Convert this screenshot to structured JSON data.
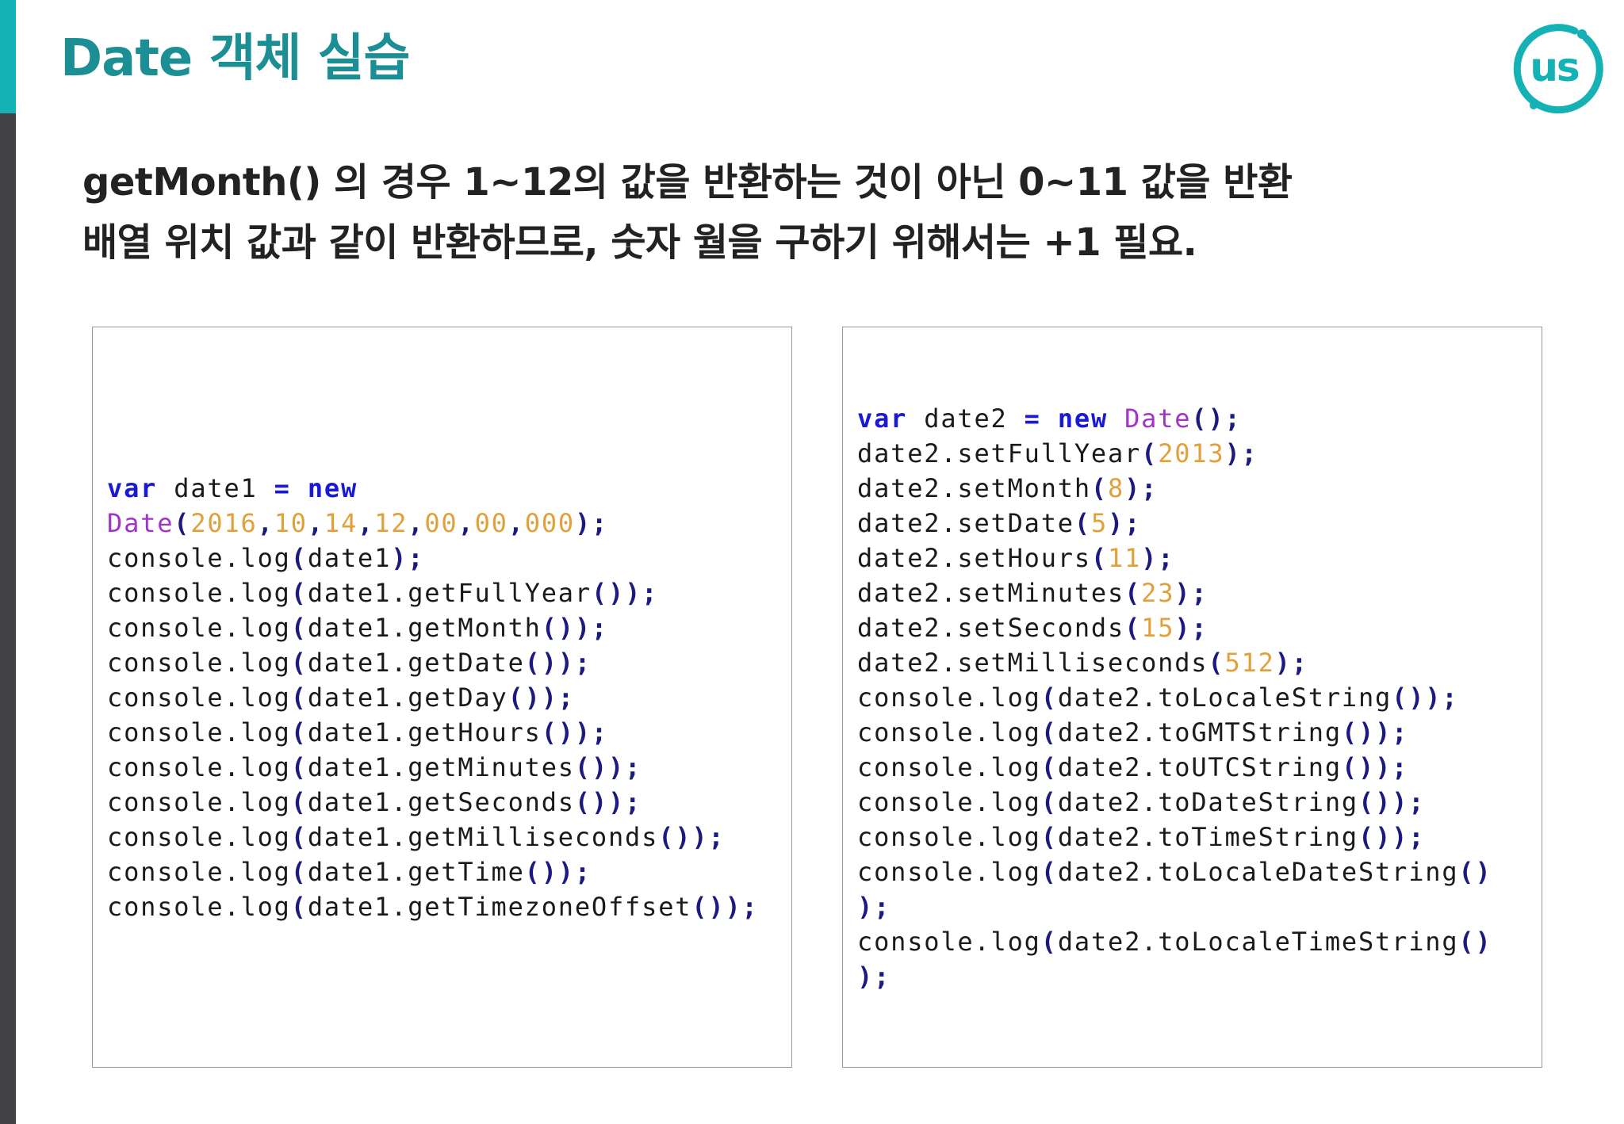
{
  "slide": {
    "title": "Date 객체 실습",
    "logo_text": "us",
    "description": [
      "getMonth() 의 경우 1~12의 값을 반환하는 것이 아닌 0~11 값을 반환",
      "배열 위치 값과 같이 반환하므로, 숫자 월을 구하기 위해서는 +1 필요."
    ]
  },
  "colors": {
    "title": "#1c8f94",
    "accent_bar": "#14b1b5",
    "side_bar": "#434246",
    "keyword": "#1a1ad4",
    "class_name": "#a233c9",
    "number": "#e0a03a",
    "punctuation": "#1a1a80"
  },
  "code_blocks": [
    {
      "lines": [
        [
          [
            "kw",
            "var"
          ],
          [
            "t",
            " date1 "
          ],
          [
            "kw",
            "="
          ],
          [
            "t",
            " "
          ],
          [
            "kw",
            "new"
          ]
        ],
        [
          [
            "cls",
            "Date"
          ],
          [
            "p",
            "("
          ],
          [
            "num",
            "2016"
          ],
          [
            "p",
            ","
          ],
          [
            "num",
            "10"
          ],
          [
            "p",
            ","
          ],
          [
            "num",
            "14"
          ],
          [
            "p",
            ","
          ],
          [
            "num",
            "12"
          ],
          [
            "p",
            ","
          ],
          [
            "num",
            "00"
          ],
          [
            "p",
            ","
          ],
          [
            "num",
            "00"
          ],
          [
            "p",
            ","
          ],
          [
            "num",
            "000"
          ],
          [
            "p",
            ");"
          ]
        ],
        [
          [
            "t",
            "console.log"
          ],
          [
            "p",
            "("
          ],
          [
            "t",
            "date1"
          ],
          [
            "p",
            ");"
          ]
        ],
        [
          [
            "t",
            "console.log"
          ],
          [
            "p",
            "("
          ],
          [
            "t",
            "date1.getFullYear"
          ],
          [
            "p",
            "());"
          ]
        ],
        [
          [
            "t",
            "console.log"
          ],
          [
            "p",
            "("
          ],
          [
            "t",
            "date1.getMonth"
          ],
          [
            "p",
            "());"
          ]
        ],
        [
          [
            "t",
            "console.log"
          ],
          [
            "p",
            "("
          ],
          [
            "t",
            "date1.getDate"
          ],
          [
            "p",
            "());"
          ]
        ],
        [
          [
            "t",
            "console.log"
          ],
          [
            "p",
            "("
          ],
          [
            "t",
            "date1.getDay"
          ],
          [
            "p",
            "());"
          ]
        ],
        [
          [
            "t",
            "console.log"
          ],
          [
            "p",
            "("
          ],
          [
            "t",
            "date1.getHours"
          ],
          [
            "p",
            "());"
          ]
        ],
        [
          [
            "t",
            "console.log"
          ],
          [
            "p",
            "("
          ],
          [
            "t",
            "date1.getMinutes"
          ],
          [
            "p",
            "());"
          ]
        ],
        [
          [
            "t",
            "console.log"
          ],
          [
            "p",
            "("
          ],
          [
            "t",
            "date1.getSeconds"
          ],
          [
            "p",
            "());"
          ]
        ],
        [
          [
            "t",
            "console.log"
          ],
          [
            "p",
            "("
          ],
          [
            "t",
            "date1.getMilliseconds"
          ],
          [
            "p",
            "());"
          ]
        ],
        [
          [
            "t",
            "console.log"
          ],
          [
            "p",
            "("
          ],
          [
            "t",
            "date1.getTime"
          ],
          [
            "p",
            "());"
          ]
        ],
        [
          [
            "t",
            "console.log"
          ],
          [
            "p",
            "("
          ],
          [
            "t",
            "date1.getTimezoneOffset"
          ],
          [
            "p",
            "());"
          ]
        ]
      ]
    },
    {
      "lines": [
        [
          [
            "kw",
            "var"
          ],
          [
            "t",
            " date2 "
          ],
          [
            "kw",
            "="
          ],
          [
            "t",
            " "
          ],
          [
            "kw",
            "new"
          ],
          [
            "t",
            " "
          ],
          [
            "cls",
            "Date"
          ],
          [
            "p",
            "();"
          ]
        ],
        [
          [
            "t",
            "date2.setFullYear"
          ],
          [
            "p",
            "("
          ],
          [
            "num",
            "2013"
          ],
          [
            "p",
            ");"
          ]
        ],
        [
          [
            "t",
            "date2.setMonth"
          ],
          [
            "p",
            "("
          ],
          [
            "num",
            "8"
          ],
          [
            "p",
            ");"
          ]
        ],
        [
          [
            "t",
            "date2.setDate"
          ],
          [
            "p",
            "("
          ],
          [
            "num",
            "5"
          ],
          [
            "p",
            ");"
          ]
        ],
        [
          [
            "t",
            "date2.setHours"
          ],
          [
            "p",
            "("
          ],
          [
            "num",
            "11"
          ],
          [
            "p",
            ");"
          ]
        ],
        [
          [
            "t",
            "date2.setMinutes"
          ],
          [
            "p",
            "("
          ],
          [
            "num",
            "23"
          ],
          [
            "p",
            ");"
          ]
        ],
        [
          [
            "t",
            "date2.setSeconds"
          ],
          [
            "p",
            "("
          ],
          [
            "num",
            "15"
          ],
          [
            "p",
            ");"
          ]
        ],
        [
          [
            "t",
            "date2.setMilliseconds"
          ],
          [
            "p",
            "("
          ],
          [
            "num",
            "512"
          ],
          [
            "p",
            ");"
          ]
        ],
        [
          [
            "t",
            "console.log"
          ],
          [
            "p",
            "("
          ],
          [
            "t",
            "date2.toLocaleString"
          ],
          [
            "p",
            "());"
          ]
        ],
        [
          [
            "t",
            "console.log"
          ],
          [
            "p",
            "("
          ],
          [
            "t",
            "date2.toGMTString"
          ],
          [
            "p",
            "());"
          ]
        ],
        [
          [
            "t",
            "console.log"
          ],
          [
            "p",
            "("
          ],
          [
            "t",
            "date2.toUTCString"
          ],
          [
            "p",
            "());"
          ]
        ],
        [
          [
            "t",
            "console.log"
          ],
          [
            "p",
            "("
          ],
          [
            "t",
            "date2.toDateString"
          ],
          [
            "p",
            "());"
          ]
        ],
        [
          [
            "t",
            "console.log"
          ],
          [
            "p",
            "("
          ],
          [
            "t",
            "date2.toTimeString"
          ],
          [
            "p",
            "());"
          ]
        ],
        [
          [
            "t",
            "console.log"
          ],
          [
            "p",
            "("
          ],
          [
            "t",
            "date2.toLocaleDateString"
          ],
          [
            "p",
            "()"
          ]
        ],
        [
          [
            "p",
            ");"
          ]
        ],
        [
          [
            "t",
            "console.log"
          ],
          [
            "p",
            "("
          ],
          [
            "t",
            "date2.toLocaleTimeString"
          ],
          [
            "p",
            "()"
          ]
        ],
        [
          [
            "p",
            ");"
          ]
        ]
      ]
    }
  ]
}
